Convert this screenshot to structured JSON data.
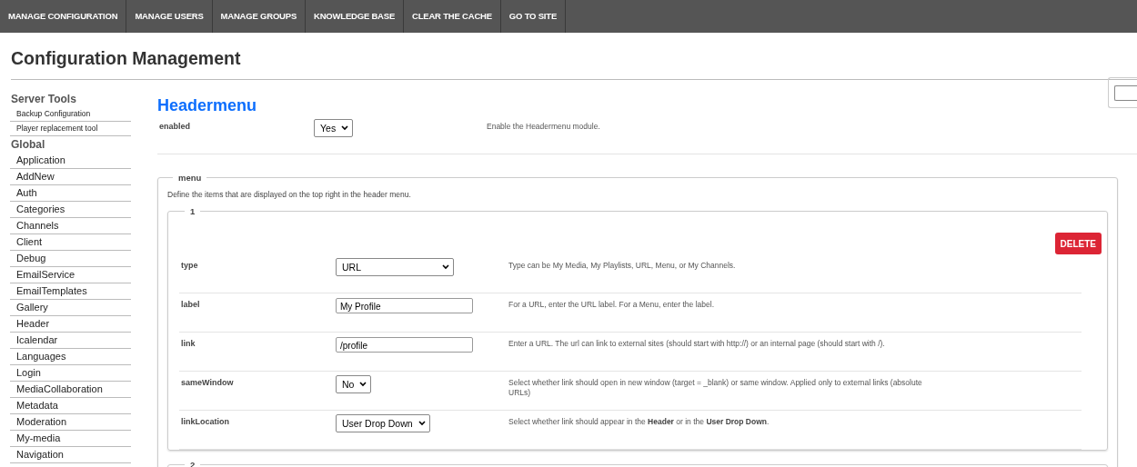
{
  "nav": [
    "MANAGE CONFIGURATION",
    "MANAGE USERS",
    "MANAGE GROUPS",
    "KNOWLEDGE BASE",
    "CLEAR THE CACHE",
    "GO TO SITE"
  ],
  "page_title": "Configuration Management",
  "sidebar": [
    {
      "heading": "Server Tools",
      "items": [
        "Backup Configuration",
        "Player replacement tool"
      ]
    },
    {
      "heading": "Global",
      "items": [
        "Application",
        "AddNew",
        "Auth",
        "Categories",
        "Channels",
        "Client",
        "Debug",
        "EmailService",
        "EmailTemplates",
        "Gallery",
        "Header",
        "Icalendar",
        "Languages",
        "Login",
        "MediaCollaboration",
        "Metadata",
        "Moderation",
        "My-media",
        "Navigation"
      ]
    }
  ],
  "module": {
    "title": "Headermenu",
    "enabled": {
      "label": "enabled",
      "value": "Yes",
      "description": "Enable the Headermenu module."
    }
  },
  "menu": {
    "legend": "menu",
    "description": "Define the items that are displayed on the top right in the header menu.",
    "items": [
      {
        "legend": "1",
        "delete": "DELETE",
        "fields": [
          {
            "label": "type",
            "kind": "select",
            "value": "URL",
            "description": "Type can be My Media, My Playlists, URL, Menu, or My Channels."
          },
          {
            "label": "label",
            "kind": "text",
            "value": "My Profile",
            "description": "For a URL, enter the URL label. For a Menu, enter the label."
          },
          {
            "label": "link",
            "kind": "text",
            "value": "/profile",
            "description": "Enter a URL. The url can link to external sites (should start with http://) or an internal page (should start with /)."
          },
          {
            "label": "sameWindow",
            "kind": "select",
            "value": "No",
            "description": "Select whether link should open in new window (target = _blank) or same window. Applied only to external links (absolute URLs)"
          },
          {
            "label": "linkLocation",
            "kind": "select",
            "value": "User Drop Down",
            "description": "Select whether link should appear in the **Header** or in the **User Drop Down**."
          }
        ]
      },
      {
        "legend": "2"
      }
    ]
  }
}
